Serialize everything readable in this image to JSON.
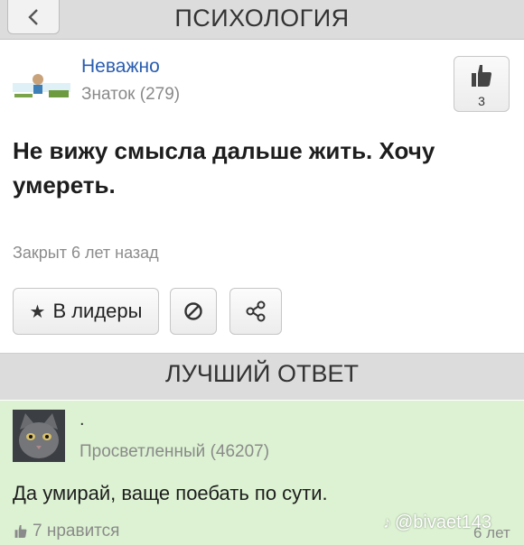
{
  "header": {
    "title": "ПСИХОЛОГИЯ",
    "back_icon": "chevron-left-icon"
  },
  "question": {
    "author_name": "Неважно",
    "author_rank": "Знаток (279)",
    "likes": "3",
    "text": "Не вижу смысла дальше жить. Хочу умереть.",
    "status": "Закрыт 6 лет назад"
  },
  "actions": {
    "leaders_label": "В лидеры",
    "leaders_icon": "star-icon",
    "block_icon": "block-icon",
    "share_icon": "share-icon"
  },
  "best_answer": {
    "section_title": "ЛУЧШИЙ ОТВЕТ",
    "author_name": ".",
    "author_rank": "Просветленный (46207)",
    "text": "Да умирай, ваще поебать по сути.",
    "likes": "7 нравится",
    "age": "6 лет",
    "watermark": "@bivaet143"
  },
  "colors": {
    "header_bg": "#dcdcdc",
    "answer_bg": "#dcf2d2",
    "link": "#2a5db0"
  }
}
